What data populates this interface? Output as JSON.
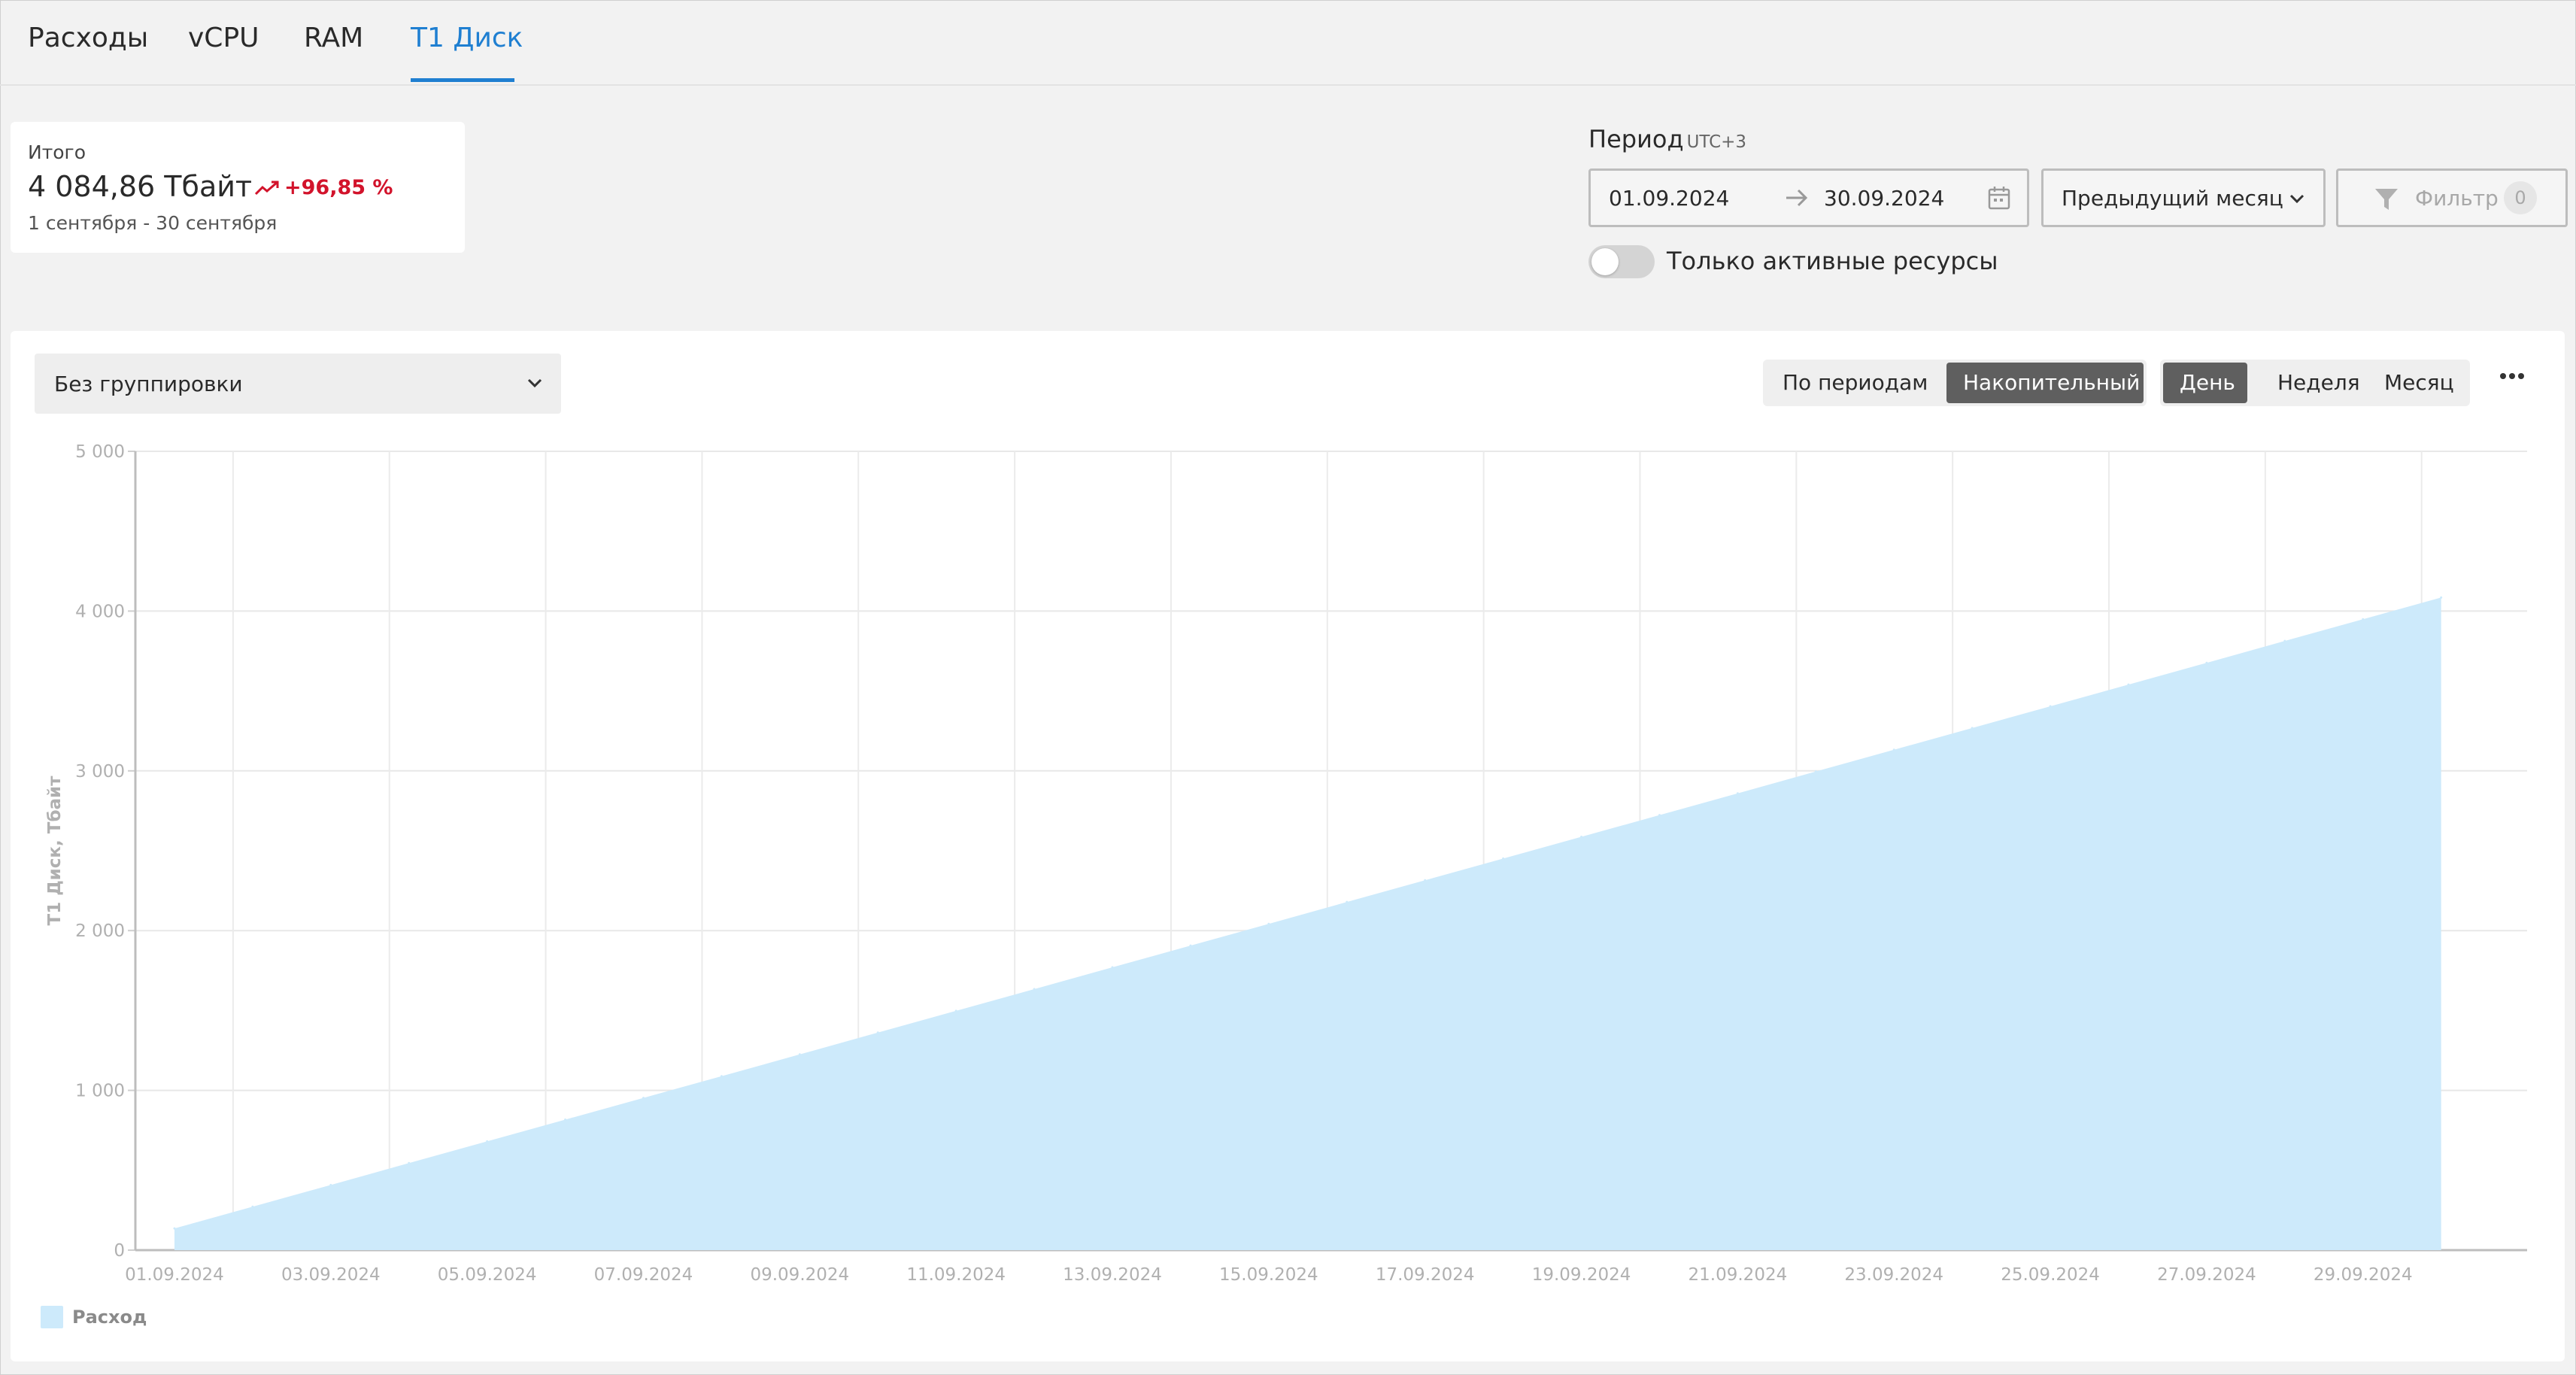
{
  "tabs": [
    {
      "label": "Расходы"
    },
    {
      "label": "vCPU"
    },
    {
      "label": "RAM"
    },
    {
      "label": "Т1 Диск",
      "active": true
    }
  ],
  "total": {
    "label": "Итого",
    "value": "4 084,86 Тбайт",
    "trend": "+96,85 %",
    "range": "1 сентября - 30 сентября"
  },
  "period": {
    "title": "Период",
    "timezone": "UTC+3",
    "from": "01.09.2024",
    "to": "30.09.2024",
    "preset": "Предыдущий месяц",
    "filter_label": "Фильтр",
    "filter_count": "0",
    "active_only_label": "Только активные ресурсы",
    "active_only": false
  },
  "controls": {
    "grouping": "Без группировки",
    "mode_options": [
      {
        "label": "По периодам",
        "active": false
      },
      {
        "label": "Накопительный",
        "active": true
      }
    ],
    "granularity_options": [
      {
        "label": "День",
        "active": true
      },
      {
        "label": "Неделя",
        "active": false
      },
      {
        "label": "Месяц",
        "active": false
      }
    ]
  },
  "colors": {
    "accent": "#1f7fd1",
    "trend_up": "#d2132b",
    "area_fill": "#cdeafb"
  },
  "chart_data": {
    "type": "area",
    "ylabel": "Т1 Диск, Тбайт",
    "ylim": [
      0,
      5000
    ],
    "y_ticks": [
      "0",
      "1 000",
      "2 000",
      "3 000",
      "4 000",
      "5 000"
    ],
    "x_ticks": [
      "01.09.2024",
      "03.09.2024",
      "05.09.2024",
      "07.09.2024",
      "09.09.2024",
      "11.09.2024",
      "13.09.2024",
      "15.09.2024",
      "17.09.2024",
      "19.09.2024",
      "21.09.2024",
      "23.09.2024",
      "25.09.2024",
      "27.09.2024",
      "29.09.2024"
    ],
    "grid": true,
    "legend_position": "bottom-left",
    "series": [
      {
        "name": "Расход",
        "x": [
          "01.09.2024",
          "02.09.2024",
          "03.09.2024",
          "04.09.2024",
          "05.09.2024",
          "06.09.2024",
          "07.09.2024",
          "08.09.2024",
          "09.09.2024",
          "10.09.2024",
          "11.09.2024",
          "12.09.2024",
          "13.09.2024",
          "14.09.2024",
          "15.09.2024",
          "16.09.2024",
          "17.09.2024",
          "18.09.2024",
          "19.09.2024",
          "20.09.2024",
          "21.09.2024",
          "22.09.2024",
          "23.09.2024",
          "24.09.2024",
          "25.09.2024",
          "26.09.2024",
          "27.09.2024",
          "28.09.2024",
          "29.09.2024",
          "30.09.2024"
        ],
        "values": [
          136,
          272,
          408,
          545,
          681,
          817,
          953,
          1089,
          1225,
          1362,
          1498,
          1634,
          1770,
          1906,
          2042,
          2179,
          2315,
          2451,
          2587,
          2723,
          2859,
          2996,
          3132,
          3268,
          3404,
          3540,
          3676,
          3813,
          3949,
          4085
        ]
      }
    ]
  }
}
